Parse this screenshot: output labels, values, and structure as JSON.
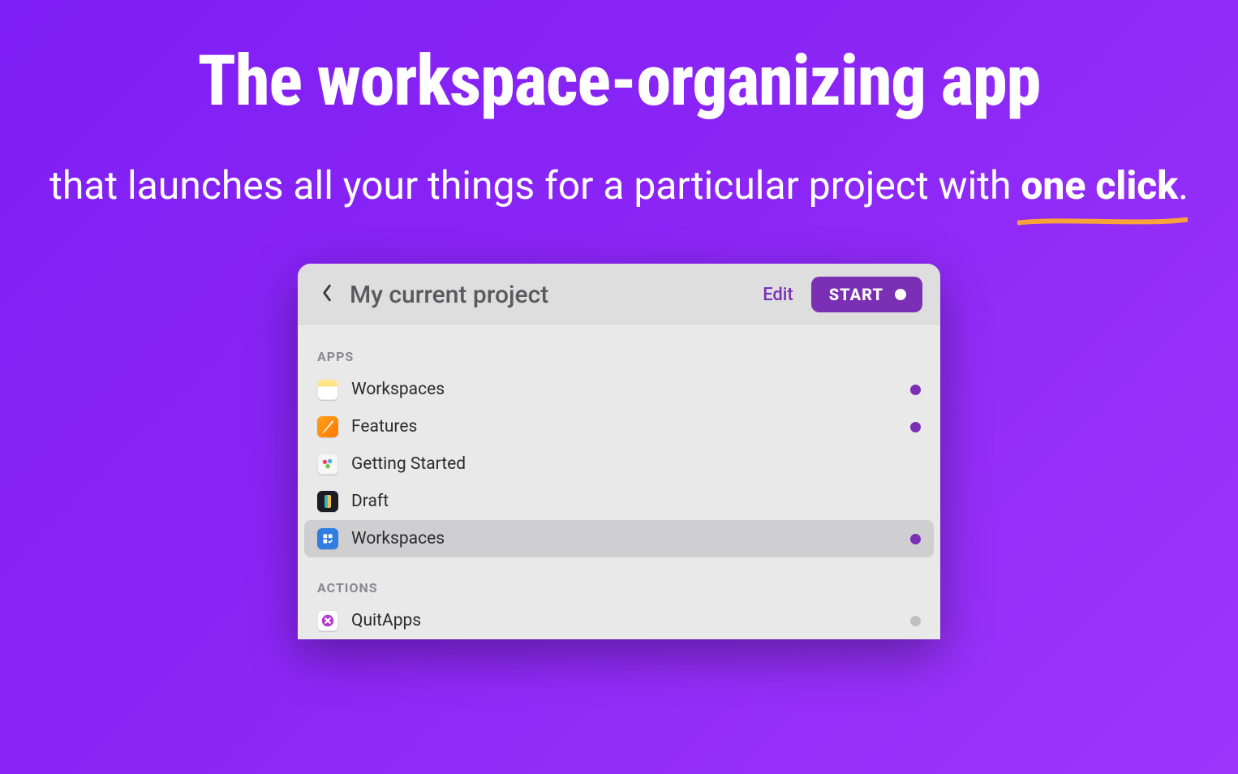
{
  "hero": {
    "title": "The workspace-organizing app",
    "subtitle_prefix": "that launches all your things for a particular project with ",
    "subtitle_emph": "one click",
    "subtitle_suffix": "."
  },
  "panel": {
    "title": "My current project",
    "edit_label": "Edit",
    "start_label": "START",
    "sections": {
      "apps": {
        "label": "APPS",
        "items": [
          {
            "name": "Workspaces",
            "icon": "notes",
            "status": "purple",
            "selected": false
          },
          {
            "name": "Features",
            "icon": "pages",
            "status": "purple",
            "selected": false
          },
          {
            "name": "Getting Started",
            "icon": "final",
            "status": "none",
            "selected": false
          },
          {
            "name": "Draft",
            "icon": "draft",
            "status": "none",
            "selected": false
          },
          {
            "name": "Workspaces",
            "icon": "things",
            "status": "purple",
            "selected": true
          }
        ]
      },
      "actions": {
        "label": "ACTIONS",
        "items": [
          {
            "name": "QuitApps",
            "icon": "quit",
            "status": "gray",
            "selected": false
          }
        ]
      }
    }
  },
  "colors": {
    "accent": "#7b2fb5",
    "underline": "#f7a23b"
  }
}
